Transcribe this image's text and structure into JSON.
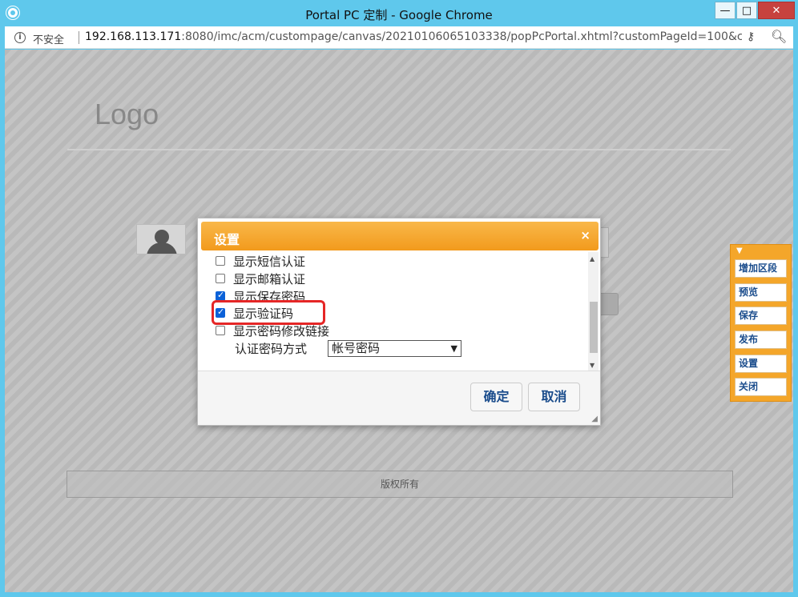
{
  "window": {
    "title": "Portal PC 定制 - Google Chrome",
    "min_label": "—",
    "max_label": "□",
    "close_label": "✕"
  },
  "address": {
    "security_label": "不安全",
    "url_host": "192.168.113.171",
    "url_rest": ":8080/imc/acm/custompage/canvas/20210106065103338/popPcPortal.xhtml?customPageId=100&cust..."
  },
  "page": {
    "logo": "Logo",
    "footer": "版权所有"
  },
  "side_toolbar": {
    "pin": "▼",
    "buttons": [
      "增加区段",
      "预览",
      "保存",
      "发布",
      "设置",
      "关闭"
    ]
  },
  "dialog": {
    "title": "设置",
    "close": "×",
    "options": [
      {
        "label": "显示短信认证",
        "checked": false
      },
      {
        "label": "显示邮箱认证",
        "checked": false
      },
      {
        "label": "显示保存密码",
        "checked": true
      },
      {
        "label": "显示验证码",
        "checked": true
      },
      {
        "label": "显示密码修改链接",
        "checked": false
      }
    ],
    "auth_method_label": "认证密码方式",
    "auth_method_value": "帐号密码",
    "ok_label": "确定",
    "cancel_label": "取消"
  },
  "colors": {
    "titlebar": "#5fc8ec",
    "dialog_header": "#f29a1c",
    "highlight": "#e52626",
    "checkbox_checked": "#0b61d8"
  }
}
